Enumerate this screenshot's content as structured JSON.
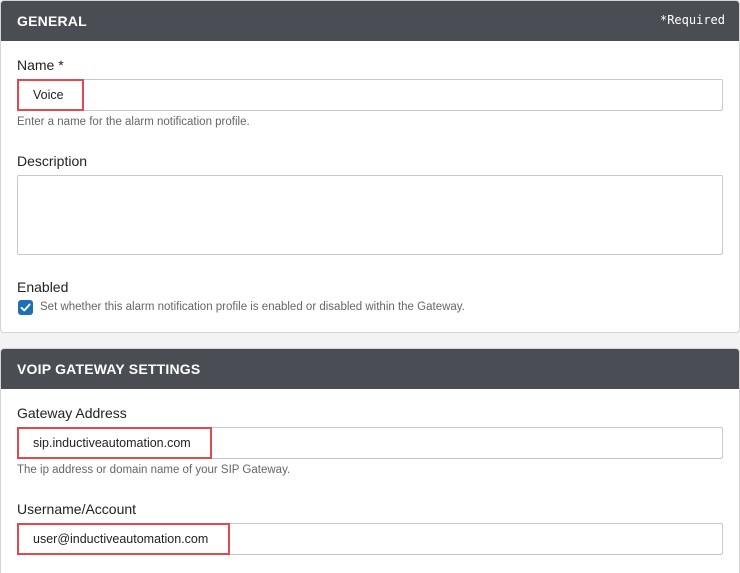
{
  "general": {
    "title": "GENERAL",
    "required_note": "*Required",
    "name": {
      "label": "Name *",
      "value": "Voice",
      "help": "Enter a name for the alarm notification profile."
    },
    "description": {
      "label": "Description",
      "value": ""
    },
    "enabled": {
      "label": "Enabled",
      "checked": true,
      "help": "Set whether this alarm notification profile is enabled or disabled within the Gateway."
    }
  },
  "voip": {
    "title": "VOIP GATEWAY SETTINGS",
    "gateway_address": {
      "label": "Gateway Address",
      "value": "sip.inductiveautomation.com",
      "help": "The ip address or domain name of your SIP Gateway."
    },
    "username": {
      "label": "Username/Account",
      "value": "user@inductiveautomation.com"
    }
  },
  "colors": {
    "header_bg": "#4a4e54",
    "highlight": "#e04a4e",
    "checkbox": "#1f6fb5"
  },
  "icons": {
    "checkbox": "checkmark-icon"
  }
}
